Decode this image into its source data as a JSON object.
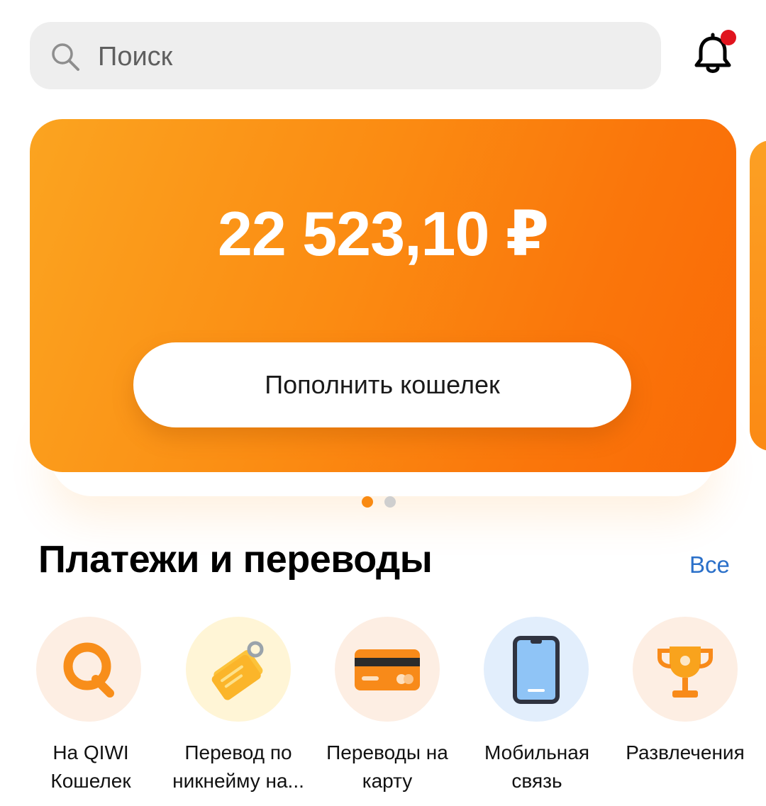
{
  "search": {
    "placeholder": "Поиск"
  },
  "balance": {
    "amount": "22 523,10 ₽",
    "topup_label": "Пополнить кошелек"
  },
  "carousel": {
    "total": 2,
    "active": 1
  },
  "payments": {
    "title": "Платежи и переводы",
    "all_label": "Все",
    "items": [
      {
        "line1": "На QIWI",
        "line2": "Кошелек",
        "icon": "qiwi-icon"
      },
      {
        "line1": "Перевод по",
        "line2": "никнейму на...",
        "icon": "tag-icon"
      },
      {
        "line1": "Переводы на",
        "line2": "карту",
        "icon": "card-icon"
      },
      {
        "line1": "Мобильная",
        "line2": "связь",
        "icon": "phone-icon"
      },
      {
        "line1": "Развлечения",
        "line2": "",
        "icon": "trophy-icon"
      }
    ]
  },
  "colors": {
    "accent": "#fb8b12",
    "link": "#2b70c9",
    "notification": "#e0141e"
  }
}
